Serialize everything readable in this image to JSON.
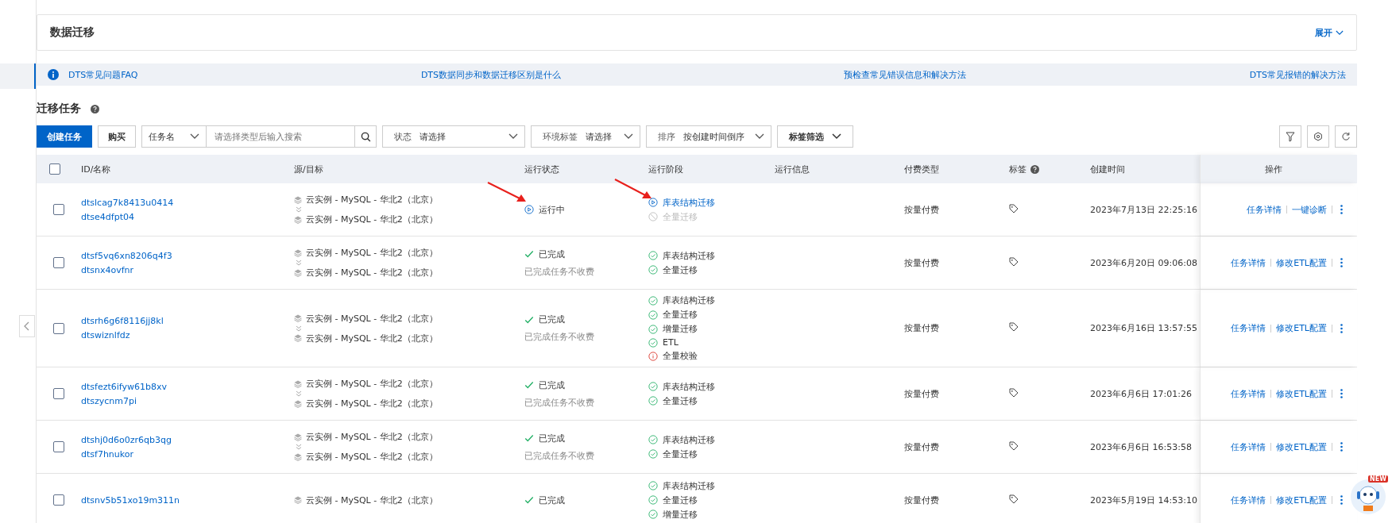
{
  "panel": {
    "title": "数据迁移",
    "toggle": "展开"
  },
  "links": [
    "DTS常见问题FAQ",
    "DTS数据同步和数据迁移区别是什么",
    "预检查常见错误信息和解决方法",
    "DTS常见报错的解决方法"
  ],
  "section": {
    "title": "迁移任务"
  },
  "toolbar": {
    "create": "创建任务",
    "buy": "购买",
    "search_type": "任务名",
    "search_placeholder": "请选择类型后输入搜索",
    "filters": [
      {
        "label": "状态",
        "value": "请选择"
      },
      {
        "label": "环境标签",
        "value": "请选择"
      },
      {
        "label": "排序",
        "value": "按创建时间倒序"
      }
    ],
    "tag_filter": "标签筛选"
  },
  "table": {
    "all_checked": false,
    "columns": [
      {
        "label": "ID/名称",
        "help": false
      },
      {
        "label": "源/目标",
        "help": false
      },
      {
        "label": "运行状态",
        "help": false
      },
      {
        "label": "运行阶段",
        "help": false
      },
      {
        "label": "运行信息",
        "help": false
      },
      {
        "label": "付费类型",
        "help": false
      },
      {
        "label": "标签",
        "help": true
      },
      {
        "label": "创建时间",
        "help": false
      },
      {
        "label": "操作",
        "help": false
      }
    ],
    "rows": [
      {
        "checked": false,
        "id": "dtslcag7k8413u0414",
        "name": "dtse4dfpt04",
        "source": "云实例 - MySQL - 华北2（北京）",
        "target": "云实例 - MySQL - 华北2（北京）",
        "status": {
          "kind": "running",
          "label": "运行中"
        },
        "stages": [
          {
            "kind": "running",
            "label": "库表结构迁移"
          },
          {
            "kind": "pending",
            "label": "全量迁移"
          }
        ],
        "billing": "按量付费",
        "created": "2023年7月13日 22:25:16",
        "actions": [
          "任务详情",
          "一键诊断"
        ]
      },
      {
        "checked": false,
        "id": "dtsf5vq6xn8206q4f3",
        "name": "dtsnx4ovfnr",
        "source": "云实例 - MySQL - 华北2（北京）",
        "target": "云实例 - MySQL - 华北2（北京）",
        "status": {
          "kind": "done",
          "label": "已完成",
          "note": "已完成任务不收费"
        },
        "stages": [
          {
            "kind": "done",
            "label": "库表结构迁移"
          },
          {
            "kind": "done",
            "label": "全量迁移"
          }
        ],
        "billing": "按量付费",
        "created": "2023年6月20日 09:06:08",
        "actions": [
          "任务详情",
          "修改ETL配置"
        ]
      },
      {
        "checked": false,
        "id": "dtsrh6g6f8116jj8kl",
        "name": "dtswiznlfdz",
        "source": "云实例 - MySQL - 华北2（北京）",
        "target": "云实例 - MySQL - 华北2（北京）",
        "status": {
          "kind": "done",
          "label": "已完成",
          "note": "已完成任务不收费"
        },
        "stages": [
          {
            "kind": "done",
            "label": "库表结构迁移"
          },
          {
            "kind": "done",
            "label": "全量迁移"
          },
          {
            "kind": "done",
            "label": "增量迁移"
          },
          {
            "kind": "done",
            "label": "ETL"
          },
          {
            "kind": "error",
            "label": "全量校验"
          }
        ],
        "billing": "按量付费",
        "created": "2023年6月16日 13:57:55",
        "actions": [
          "任务详情",
          "修改ETL配置"
        ]
      },
      {
        "checked": false,
        "id": "dtsfezt6ifyw61b8xv",
        "name": "dtszycnm7pi",
        "source": "云实例 - MySQL - 华北2（北京）",
        "target": "云实例 - MySQL - 华北2（北京）",
        "status": {
          "kind": "done",
          "label": "已完成",
          "note": "已完成任务不收费"
        },
        "stages": [
          {
            "kind": "done",
            "label": "库表结构迁移"
          },
          {
            "kind": "done",
            "label": "全量迁移"
          }
        ],
        "billing": "按量付费",
        "created": "2023年6月6日 17:01:26",
        "actions": [
          "任务详情",
          "修改ETL配置"
        ]
      },
      {
        "checked": false,
        "id": "dtshj0d6o0zr6qb3qg",
        "name": "dtsf7hnukor",
        "source": "云实例 - MySQL - 华北2（北京）",
        "target": "云实例 - MySQL - 华北2（北京）",
        "status": {
          "kind": "done",
          "label": "已完成",
          "note": "已完成任务不收费"
        },
        "stages": [
          {
            "kind": "done",
            "label": "库表结构迁移"
          },
          {
            "kind": "done",
            "label": "全量迁移"
          }
        ],
        "billing": "按量付费",
        "created": "2023年6月6日 16:53:58",
        "actions": [
          "任务详情",
          "修改ETL配置"
        ]
      },
      {
        "checked": false,
        "id": "dtsnv5b51xo19m311n",
        "source": "云实例 - MySQL - 华北2（北京）",
        "status": {
          "kind": "done",
          "label": "已完成"
        },
        "stages": [
          {
            "kind": "done",
            "label": "库表结构迁移"
          },
          {
            "kind": "done",
            "label": "全量迁移"
          },
          {
            "kind": "done",
            "label": "增量迁移"
          }
        ],
        "billing": "按量付费",
        "created": "2023年5月19日 14:53:10",
        "actions": [
          "任务详情",
          "修改ETL配置"
        ]
      }
    ]
  },
  "assistant": {
    "badge": "NEW"
  }
}
